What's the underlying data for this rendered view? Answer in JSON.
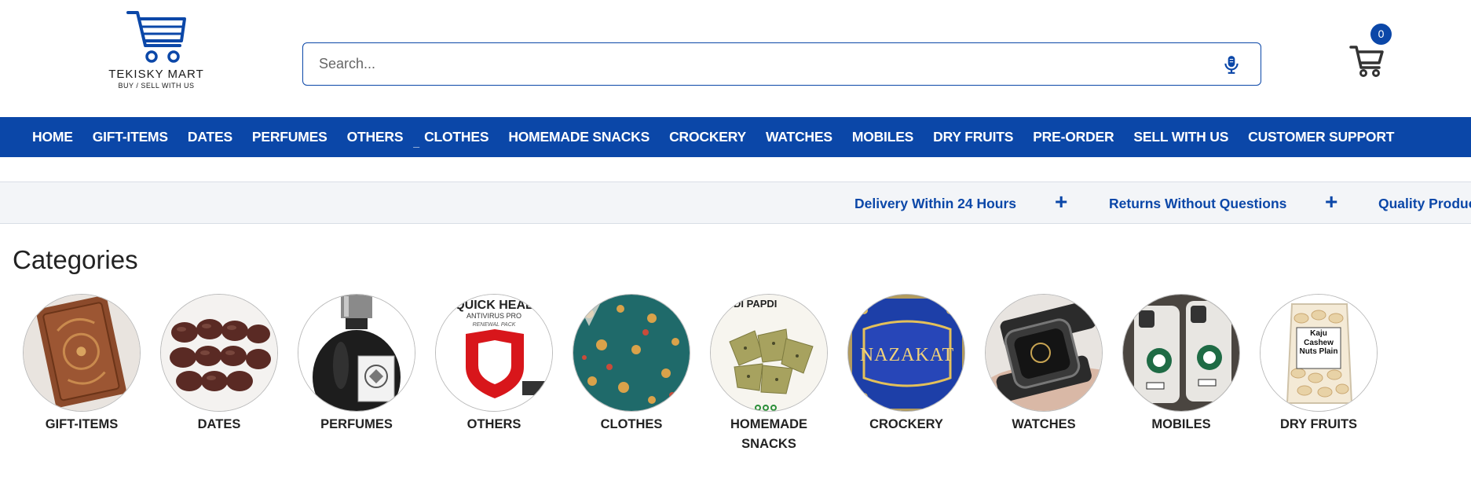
{
  "logo": {
    "brand": "TEKISKY MART",
    "tagline": "BUY / SELL WITH US",
    "icon": "cart-logo-icon"
  },
  "search": {
    "placeholder": "Search...",
    "value": "",
    "mic_icon": "microphone-icon"
  },
  "cart": {
    "count": "0",
    "icon": "cart-icon"
  },
  "nav": {
    "items": [
      {
        "label": "HOME"
      },
      {
        "label": "GIFT-ITEMS"
      },
      {
        "label": "DATES"
      },
      {
        "label": "PERFUMES"
      },
      {
        "label": "OTHERS"
      },
      {
        "label": "CLOTHES"
      },
      {
        "label": "HOMEMADE SNACKS"
      },
      {
        "label": "CROCKERY"
      },
      {
        "label": "WATCHES"
      },
      {
        "label": "MOBILES"
      },
      {
        "label": "DRY FRUITS"
      },
      {
        "label": "PRE-ORDER"
      },
      {
        "label": "SELL WITH US"
      },
      {
        "label": "CUSTOMER SUPPORT"
      }
    ],
    "separator": "_"
  },
  "features": {
    "items": [
      {
        "label": "Delivery Within 24 Hours"
      },
      {
        "label": "Returns Without Questions"
      },
      {
        "label": "Quality Produc"
      }
    ],
    "plus": "+"
  },
  "categories": {
    "title": "Categories",
    "items": [
      {
        "label": "GIFT-ITEMS"
      },
      {
        "label": "DATES"
      },
      {
        "label": "PERFUMES"
      },
      {
        "label": "OTHERS"
      },
      {
        "label": "CLOTHES"
      },
      {
        "label": "HOMEMADE SNACKS"
      },
      {
        "label": "CROCKERY"
      },
      {
        "label": "WATCHES"
      },
      {
        "label": "MOBILES"
      },
      {
        "label": "DRY FRUITS"
      }
    ],
    "image_texts": {
      "others_brand": "QUICK HEAL",
      "others_sub1": "ANTIVIRUS PRO",
      "others_sub2": "RENEWAL PACK",
      "snacks_text": "NDI PAPDI",
      "crockery_text": "NAZAKAT",
      "dryfruits_text": "Kaju Cashew Nuts Plain"
    }
  },
  "colors": {
    "brand": "#0b47a8",
    "strip": "#f3f5f8",
    "text": "#222222"
  }
}
